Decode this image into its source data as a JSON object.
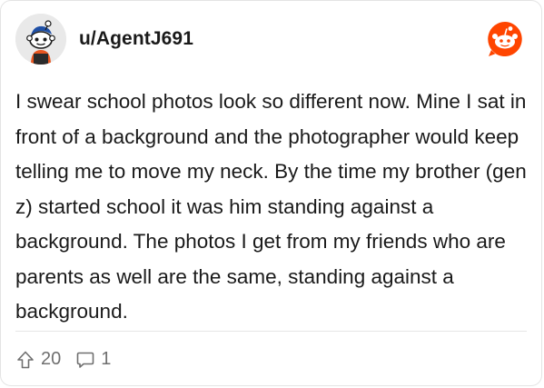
{
  "post": {
    "username": "u/AgentJ691",
    "body": "I swear school photos look so different now. Mine I sat in front of a background and the photographer would keep telling me to move my neck. By the time my brother (gen z) started school it was him standing against a background. The photos I get from my friends who are parents as well are the same, standing against a background.",
    "upvotes": "20",
    "comments": "1"
  },
  "icons": {
    "avatar": "snoo-avatar",
    "logo": "reddit-logo-icon",
    "upvote": "upvote-arrow-icon",
    "comment": "comment-bubble-icon"
  },
  "colors": {
    "brand": "#ff4500",
    "text": "#1a1a1a",
    "muted": "#6f6f6f"
  }
}
